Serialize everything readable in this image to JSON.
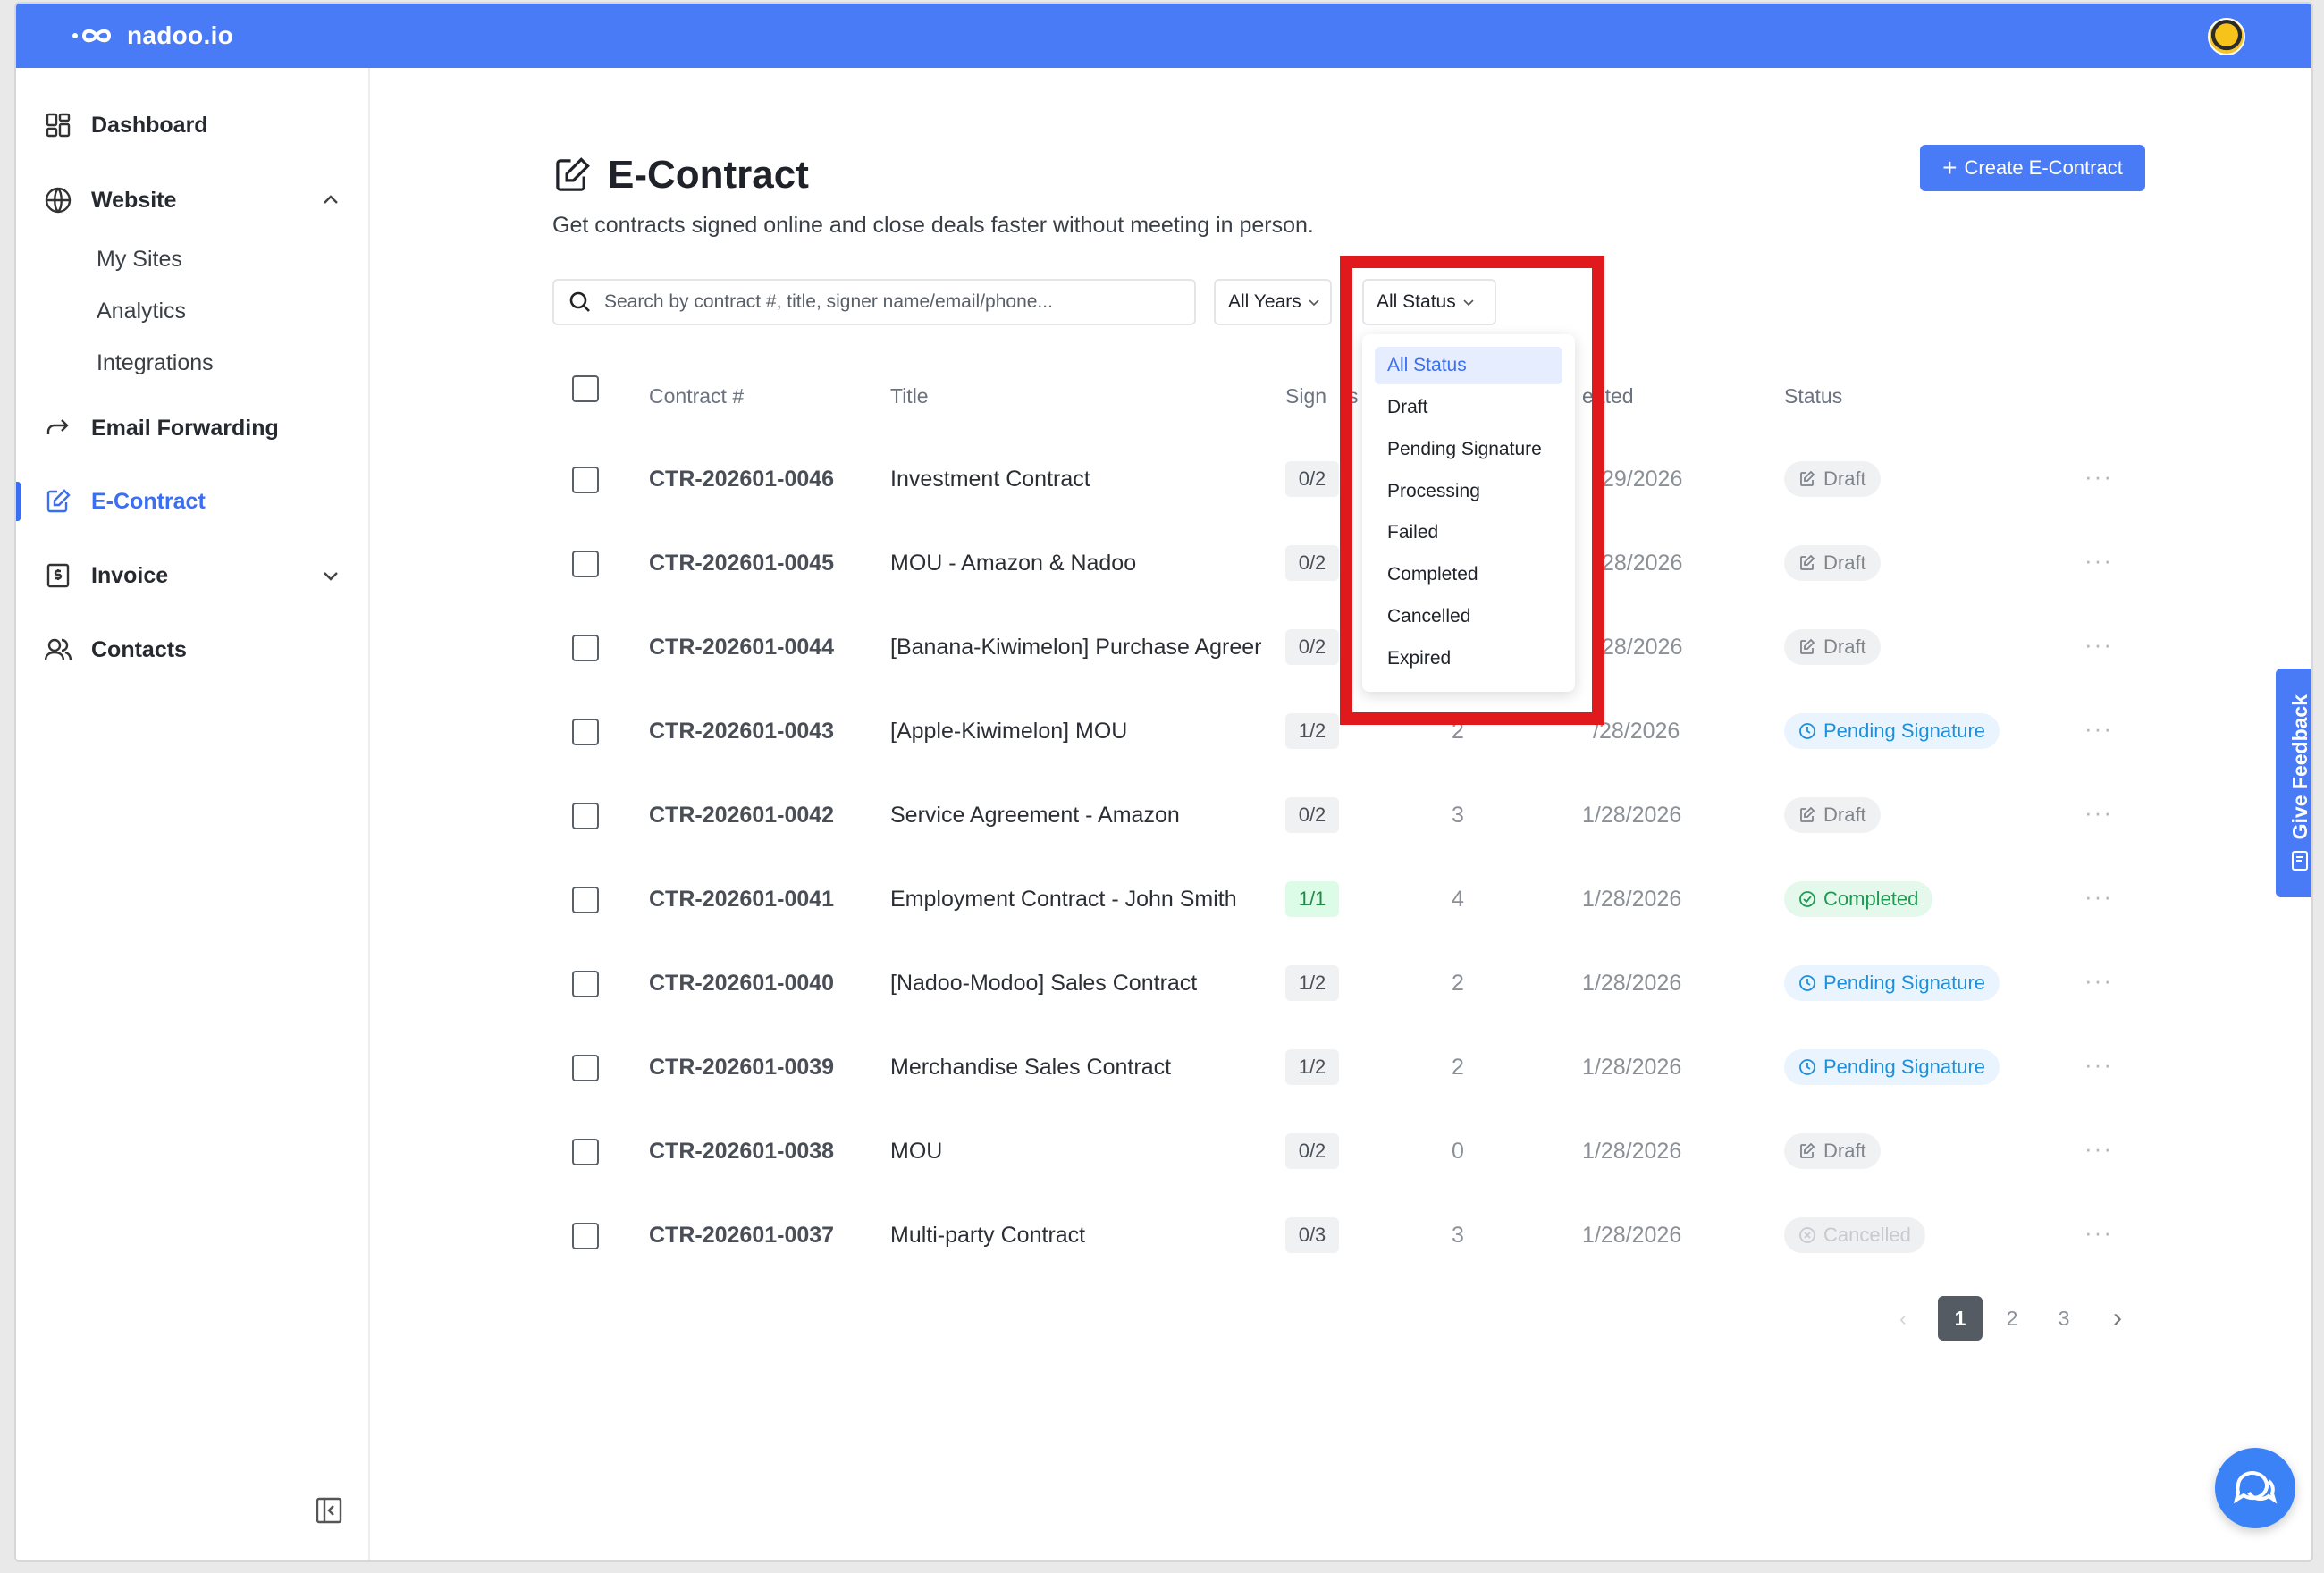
{
  "app": {
    "brand": "nadoo.io",
    "accent_color": "#4a7bf7",
    "highlight_color": "#e0191c"
  },
  "sidebar": {
    "items": [
      {
        "label": "Dashboard",
        "icon": "dashboard-grid-icon"
      },
      {
        "label": "Website",
        "icon": "globe-icon",
        "expanded": true,
        "children": [
          "My Sites",
          "Analytics",
          "Integrations"
        ]
      },
      {
        "label": "Email Forwarding",
        "icon": "forward-arrow-icon"
      },
      {
        "label": "E-Contract",
        "icon": "edit-document-icon",
        "active": true
      },
      {
        "label": "Invoice",
        "icon": "dollar-receipt-icon",
        "expanded": false
      },
      {
        "label": "Contacts",
        "icon": "users-icon"
      }
    ]
  },
  "page": {
    "title": "E-Contract",
    "subtitle": "Get contracts signed online and close deals faster without meeting in person.",
    "create_button": "Create E-Contract"
  },
  "filters": {
    "search_placeholder": "Search by contract #, title, signer name/email/phone...",
    "year_selected": "All Years",
    "status_selected": "All Status"
  },
  "status_dropdown": {
    "open": true,
    "options": [
      "All Status",
      "Draft",
      "Pending Signature",
      "Processing",
      "Failed",
      "Completed",
      "Cancelled",
      "Expired"
    ],
    "selected_index": 0
  },
  "table": {
    "headers": [
      "Contract #",
      "Title",
      "Signed",
      "Signers",
      "Created",
      "Status"
    ],
    "visible_headers": {
      "contract": "Contract #",
      "title": "Title",
      "signed_partial": "Sign",
      "signed_tail": "s",
      "created_partial": "eated",
      "status": "Status"
    },
    "rows": [
      {
        "id": "CTR-202601-0046",
        "title": "Investment Contract",
        "signed": "0/2",
        "signers": "",
        "created_visible": "29/2026",
        "status": "Draft"
      },
      {
        "id": "CTR-202601-0045",
        "title": "MOU - Amazon & Nadoo",
        "signed": "0/2",
        "signers": "",
        "created_visible": "28/2026",
        "status": "Draft"
      },
      {
        "id": "CTR-202601-0044",
        "title": "[Banana-Kiwimelon] Purchase Agreer",
        "signed": "0/2",
        "signers": "",
        "created_visible": "28/2026",
        "status": "Draft"
      },
      {
        "id": "CTR-202601-0043",
        "title": "[Apple-Kiwimelon] MOU",
        "signed": "1/2",
        "signers": "2",
        "created_visible": "/28/2026",
        "status": "Pending Signature"
      },
      {
        "id": "CTR-202601-0042",
        "title": "Service Agreement - Amazon",
        "signed": "0/2",
        "signers": "3",
        "created_visible": "1/28/2026",
        "status": "Draft"
      },
      {
        "id": "CTR-202601-0041",
        "title": "Employment Contract - John Smith",
        "signed": "1/1",
        "signers": "4",
        "created_visible": "1/28/2026",
        "status": "Completed"
      },
      {
        "id": "CTR-202601-0040",
        "title": "[Nadoo-Modoo] Sales Contract",
        "signed": "1/2",
        "signers": "2",
        "created_visible": "1/28/2026",
        "status": "Pending Signature"
      },
      {
        "id": "CTR-202601-0039",
        "title": "Merchandise Sales Contract",
        "signed": "1/2",
        "signers": "2",
        "created_visible": "1/28/2026",
        "status": "Pending Signature"
      },
      {
        "id": "CTR-202601-0038",
        "title": "MOU",
        "signed": "0/2",
        "signers": "0",
        "created_visible": "1/28/2026",
        "status": "Draft"
      },
      {
        "id": "CTR-202601-0037",
        "title": "Multi-party Contract",
        "signed": "0/3",
        "signers": "3",
        "created_visible": "1/28/2026",
        "status": "Cancelled"
      }
    ],
    "more_label": "···"
  },
  "pagination": {
    "pages": [
      "1",
      "2",
      "3"
    ],
    "current": "1"
  },
  "feedback": {
    "label": "Give Feedback"
  }
}
